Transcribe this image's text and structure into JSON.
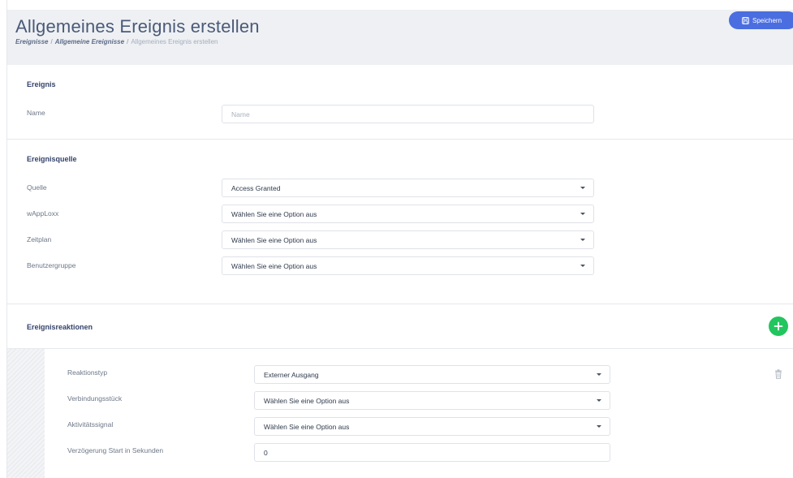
{
  "header": {
    "title": "Allgemeines Ereignis erstellen",
    "breadcrumb": [
      "Ereignisse",
      "Allgemeine Ereignisse",
      "Allgemeines Ereignis erstellen"
    ],
    "breadcrumb_sep": "/",
    "save_label": "Speichern"
  },
  "event": {
    "section_title": "Ereignis",
    "name_label": "Name",
    "name_placeholder": "Name",
    "name_value": ""
  },
  "source": {
    "section_title": "Ereignisquelle",
    "fields": [
      {
        "label": "Quelle",
        "value": "Access Granted"
      },
      {
        "label": "wAppLoxx",
        "value": "Wählen Sie eine Option aus"
      },
      {
        "label": "Zeitplan",
        "value": "Wählen Sie eine Option aus"
      },
      {
        "label": "Benutzergruppe",
        "value": "Wählen Sie eine Option aus"
      }
    ]
  },
  "reactions": {
    "section_title": "Ereignisreaktionen",
    "add_icon": "plus-icon",
    "delete_icon": "trash-icon",
    "fields": [
      {
        "label": "Reaktionstyp",
        "value": "Externer Ausgang"
      },
      {
        "label": "Verbindungsstück",
        "value": "Wählen Sie eine Option aus"
      },
      {
        "label": "Aktivitätssignal",
        "value": "Wählen Sie eine Option aus"
      },
      {
        "label": "Verzögerung Start in Sekunden",
        "value": "0"
      }
    ]
  },
  "colors": {
    "primary": "#4a6ee0",
    "add": "#22c55e",
    "header_bg": "#eef0f3"
  }
}
